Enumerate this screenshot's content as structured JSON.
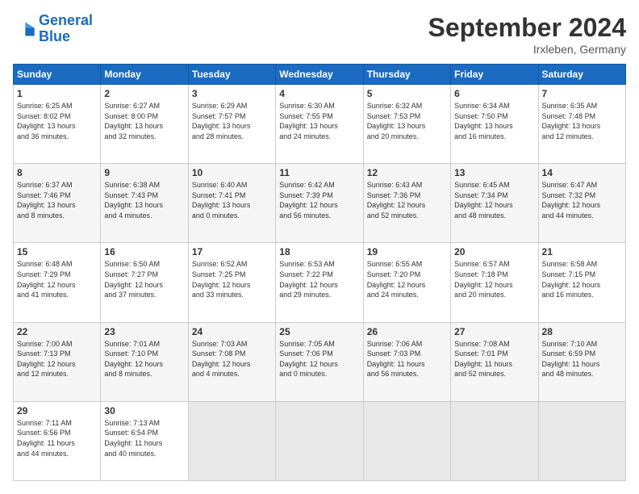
{
  "header": {
    "logo_line1": "General",
    "logo_line2": "Blue",
    "title": "September 2024",
    "location": "Irxleben, Germany"
  },
  "days_header": [
    "Sunday",
    "Monday",
    "Tuesday",
    "Wednesday",
    "Thursday",
    "Friday",
    "Saturday"
  ],
  "weeks": [
    [
      {
        "day": "1",
        "info": "Sunrise: 6:25 AM\nSunset: 8:02 PM\nDaylight: 13 hours\nand 36 minutes."
      },
      {
        "day": "2",
        "info": "Sunrise: 6:27 AM\nSunset: 8:00 PM\nDaylight: 13 hours\nand 32 minutes."
      },
      {
        "day": "3",
        "info": "Sunrise: 6:29 AM\nSunset: 7:57 PM\nDaylight: 13 hours\nand 28 minutes."
      },
      {
        "day": "4",
        "info": "Sunrise: 6:30 AM\nSunset: 7:55 PM\nDaylight: 13 hours\nand 24 minutes."
      },
      {
        "day": "5",
        "info": "Sunrise: 6:32 AM\nSunset: 7:53 PM\nDaylight: 13 hours\nand 20 minutes."
      },
      {
        "day": "6",
        "info": "Sunrise: 6:34 AM\nSunset: 7:50 PM\nDaylight: 13 hours\nand 16 minutes."
      },
      {
        "day": "7",
        "info": "Sunrise: 6:35 AM\nSunset: 7:48 PM\nDaylight: 13 hours\nand 12 minutes."
      }
    ],
    [
      {
        "day": "8",
        "info": "Sunrise: 6:37 AM\nSunset: 7:46 PM\nDaylight: 13 hours\nand 8 minutes."
      },
      {
        "day": "9",
        "info": "Sunrise: 6:38 AM\nSunset: 7:43 PM\nDaylight: 13 hours\nand 4 minutes."
      },
      {
        "day": "10",
        "info": "Sunrise: 6:40 AM\nSunset: 7:41 PM\nDaylight: 13 hours\nand 0 minutes."
      },
      {
        "day": "11",
        "info": "Sunrise: 6:42 AM\nSunset: 7:39 PM\nDaylight: 12 hours\nand 56 minutes."
      },
      {
        "day": "12",
        "info": "Sunrise: 6:43 AM\nSunset: 7:36 PM\nDaylight: 12 hours\nand 52 minutes."
      },
      {
        "day": "13",
        "info": "Sunrise: 6:45 AM\nSunset: 7:34 PM\nDaylight: 12 hours\nand 48 minutes."
      },
      {
        "day": "14",
        "info": "Sunrise: 6:47 AM\nSunset: 7:32 PM\nDaylight: 12 hours\nand 44 minutes."
      }
    ],
    [
      {
        "day": "15",
        "info": "Sunrise: 6:48 AM\nSunset: 7:29 PM\nDaylight: 12 hours\nand 41 minutes."
      },
      {
        "day": "16",
        "info": "Sunrise: 6:50 AM\nSunset: 7:27 PM\nDaylight: 12 hours\nand 37 minutes."
      },
      {
        "day": "17",
        "info": "Sunrise: 6:52 AM\nSunset: 7:25 PM\nDaylight: 12 hours\nand 33 minutes."
      },
      {
        "day": "18",
        "info": "Sunrise: 6:53 AM\nSunset: 7:22 PM\nDaylight: 12 hours\nand 29 minutes."
      },
      {
        "day": "19",
        "info": "Sunrise: 6:55 AM\nSunset: 7:20 PM\nDaylight: 12 hours\nand 24 minutes."
      },
      {
        "day": "20",
        "info": "Sunrise: 6:57 AM\nSunset: 7:18 PM\nDaylight: 12 hours\nand 20 minutes."
      },
      {
        "day": "21",
        "info": "Sunrise: 6:58 AM\nSunset: 7:15 PM\nDaylight: 12 hours\nand 16 minutes."
      }
    ],
    [
      {
        "day": "22",
        "info": "Sunrise: 7:00 AM\nSunset: 7:13 PM\nDaylight: 12 hours\nand 12 minutes."
      },
      {
        "day": "23",
        "info": "Sunrise: 7:01 AM\nSunset: 7:10 PM\nDaylight: 12 hours\nand 8 minutes."
      },
      {
        "day": "24",
        "info": "Sunrise: 7:03 AM\nSunset: 7:08 PM\nDaylight: 12 hours\nand 4 minutes."
      },
      {
        "day": "25",
        "info": "Sunrise: 7:05 AM\nSunset: 7:06 PM\nDaylight: 12 hours\nand 0 minutes."
      },
      {
        "day": "26",
        "info": "Sunrise: 7:06 AM\nSunset: 7:03 PM\nDaylight: 11 hours\nand 56 minutes."
      },
      {
        "day": "27",
        "info": "Sunrise: 7:08 AM\nSunset: 7:01 PM\nDaylight: 11 hours\nand 52 minutes."
      },
      {
        "day": "28",
        "info": "Sunrise: 7:10 AM\nSunset: 6:59 PM\nDaylight: 11 hours\nand 48 minutes."
      }
    ],
    [
      {
        "day": "29",
        "info": "Sunrise: 7:11 AM\nSunset: 6:56 PM\nDaylight: 11 hours\nand 44 minutes."
      },
      {
        "day": "30",
        "info": "Sunrise: 7:13 AM\nSunset: 6:54 PM\nDaylight: 11 hours\nand 40 minutes."
      },
      {
        "day": "",
        "info": ""
      },
      {
        "day": "",
        "info": ""
      },
      {
        "day": "",
        "info": ""
      },
      {
        "day": "",
        "info": ""
      },
      {
        "day": "",
        "info": ""
      }
    ]
  ]
}
